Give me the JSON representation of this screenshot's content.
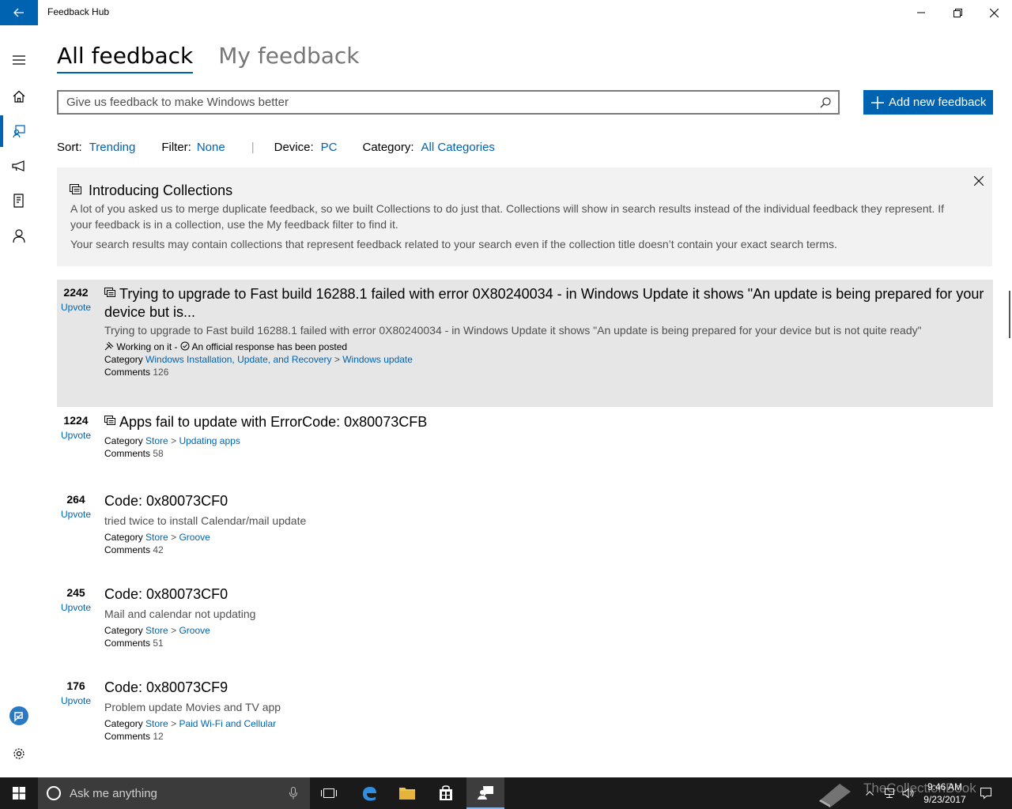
{
  "app": {
    "title": "Feedback Hub"
  },
  "pivot": {
    "all_feedback": "All feedback",
    "my_feedback": "My feedback"
  },
  "search": {
    "placeholder": "Give us feedback to make Windows better"
  },
  "add_button": {
    "label": "Add new feedback"
  },
  "filters": {
    "sort_label": "Sort:",
    "sort_value": "Trending",
    "filter_label": "Filter:",
    "filter_value": "None",
    "device_label": "Device:",
    "device_value": "PC",
    "category_label": "Category:",
    "category_value": "All Categories"
  },
  "banner": {
    "title": "Introducing Collections",
    "paragraph1": "A lot of you asked us to merge duplicate feedback, so we built Collections to do just that. Collections will show in search results instead of the individual feedback they represent. If your feedback is in a collection, use the My feedback filter to find it.",
    "paragraph2": "Your search results may contain collections that represent feedback related to your search even if the collection title doesn’t contain your exact search terms."
  },
  "feedback": [
    {
      "votes": "2242",
      "upvote": "Upvote",
      "title": "Trying to upgrade to Fast build 16288.1 failed with error 0X80240034 - in Windows Update it shows \"An update is being prepared for your device but is...",
      "description": "Trying to upgrade to Fast build 16288.1 failed with error 0X80240034 - in Windows Update it shows \"An update is being prepared for your device but is not quite ready\"",
      "status": "Working on it -",
      "response": "An official response has been posted",
      "category_label": "Category",
      "category": "Windows Installation, Update, and Recovery",
      "subcategory": "Windows update",
      "comments_label": "Comments",
      "comments": "126"
    },
    {
      "votes": "1224",
      "upvote": "Upvote",
      "title": "Apps fail to update with ErrorCode: 0x80073CFB",
      "category_label": "Category",
      "category": "Store",
      "subcategory": "Updating apps",
      "comments_label": "Comments",
      "comments": "58"
    },
    {
      "votes": "264",
      "upvote": "Upvote",
      "title": "Code: 0x80073CF0",
      "description": "tried twice to install Calendar/mail update",
      "category_label": "Category",
      "category": "Store",
      "subcategory": "Groove",
      "comments_label": "Comments",
      "comments": "42"
    },
    {
      "votes": "245",
      "upvote": "Upvote",
      "title": "Code: 0x80073CF0",
      "description": "Mail and calendar not updating",
      "category_label": "Category",
      "category": "Store",
      "subcategory": "Groove",
      "comments_label": "Comments",
      "comments": "51"
    },
    {
      "votes": "176",
      "upvote": "Upvote",
      "title": "Code: 0x80073CF9",
      "description": "Problem update Movies and TV app",
      "category_label": "Category",
      "category": "Store",
      "subcategory": "Paid Wi-Fi and Cellular",
      "comments_label": "Comments",
      "comments": "12"
    }
  ],
  "separator": ">",
  "taskbar": {
    "search_placeholder": "Ask me anything",
    "time": "9:46 AM",
    "date": "9/23/2017",
    "watermark": "TheCollectionBook"
  },
  "colors": {
    "accent": "#0063b1",
    "banner_bg": "#f2f2f2",
    "highlight_bg": "#e6e6e6",
    "taskbar_bg": "#1a1a1a"
  }
}
